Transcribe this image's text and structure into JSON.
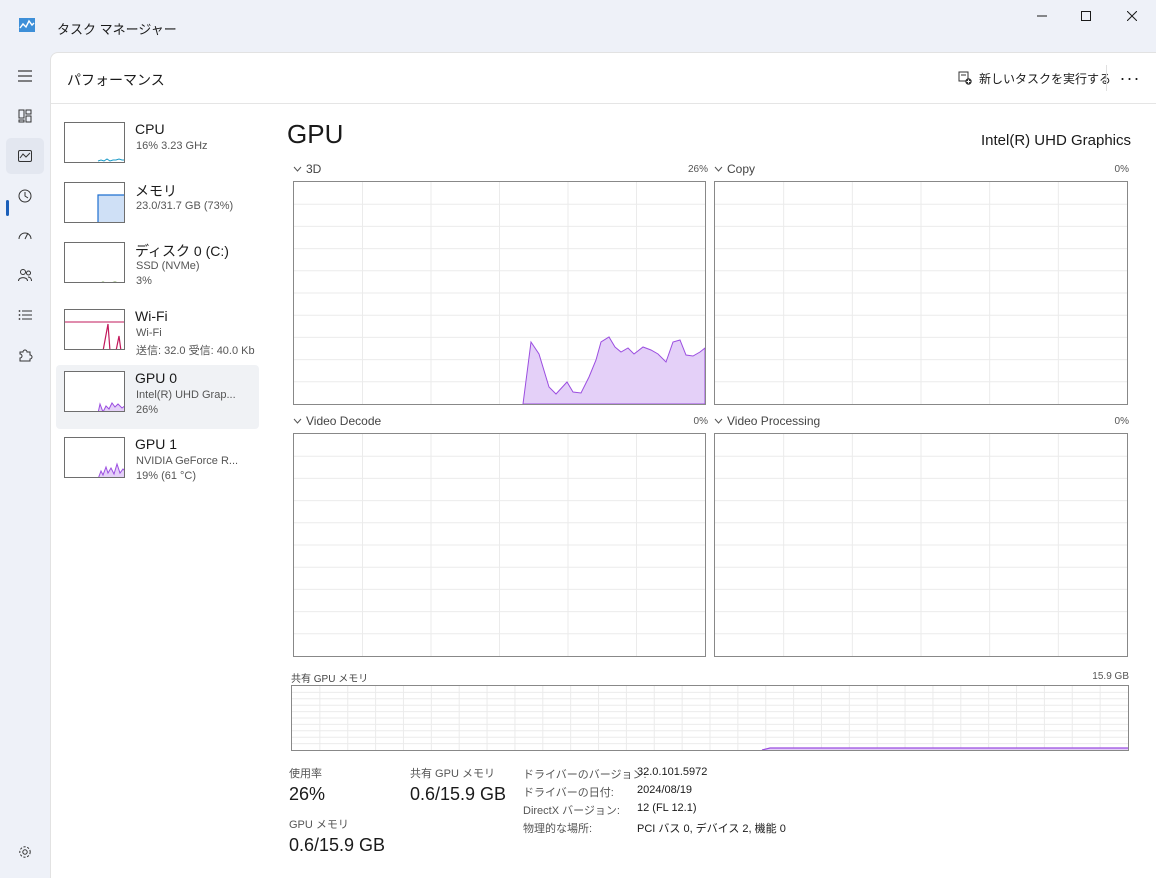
{
  "window": {
    "title": "タスク マネージャー"
  },
  "header": {
    "title": "パフォーマンス",
    "run_task": "新しいタスクを実行する"
  },
  "devices": [
    {
      "name": "CPU",
      "line1": "16%  3.23 GHz",
      "line2": ""
    },
    {
      "name": "メモリ",
      "line1": "23.0/31.7 GB (73%)",
      "line2": ""
    },
    {
      "name": "ディスク 0 (C:)",
      "line1": "SSD (NVMe)",
      "line2": "3%"
    },
    {
      "name": "Wi-Fi",
      "line1": "Wi-Fi",
      "line2": "送信: 32.0 受信: 40.0 Kb"
    },
    {
      "name": "GPU 0",
      "line1": "Intel(R) UHD Grap...",
      "line2": "26%"
    },
    {
      "name": "GPU 1",
      "line1": "NVIDIA GeForce R...",
      "line2": "19% (61 °C)"
    }
  ],
  "gpu": {
    "title": "GPU",
    "model": "Intel(R) UHD Graphics",
    "engines": [
      {
        "label": "3D",
        "percent": "26%"
      },
      {
        "label": "Copy",
        "percent": "0%"
      },
      {
        "label": "Video Decode",
        "percent": "0%"
      },
      {
        "label": "Video Processing",
        "percent": "0%"
      }
    ],
    "shared_memory": {
      "label": "共有 GPU メモリ",
      "max": "15.9 GB"
    },
    "stats": {
      "utilization_label": "使用率",
      "utilization_value": "26%",
      "shared_label": "共有 GPU メモリ",
      "shared_value": "0.6/15.9 GB",
      "gpu_memory_label": "GPU メモリ",
      "gpu_memory_value": "0.6/15.9 GB"
    },
    "details": [
      {
        "key": "ドライバーのバージョン:",
        "value": "32.0.101.5972"
      },
      {
        "key": "ドライバーの日付:",
        "value": "2024/08/19"
      },
      {
        "key": "DirectX バージョン:",
        "value": "12 (FL 12.1)"
      },
      {
        "key": "物理的な場所:",
        "value": "PCI バス 0, デバイス 2, 機能 0"
      }
    ]
  },
  "colors": {
    "accent": "#1b5fb9",
    "gpu": "#9b4ee0",
    "gpu_fill": "#e4d0f8",
    "memory": "#1e6fd0",
    "network": "#c2185b",
    "cpu": "#1899c7"
  }
}
